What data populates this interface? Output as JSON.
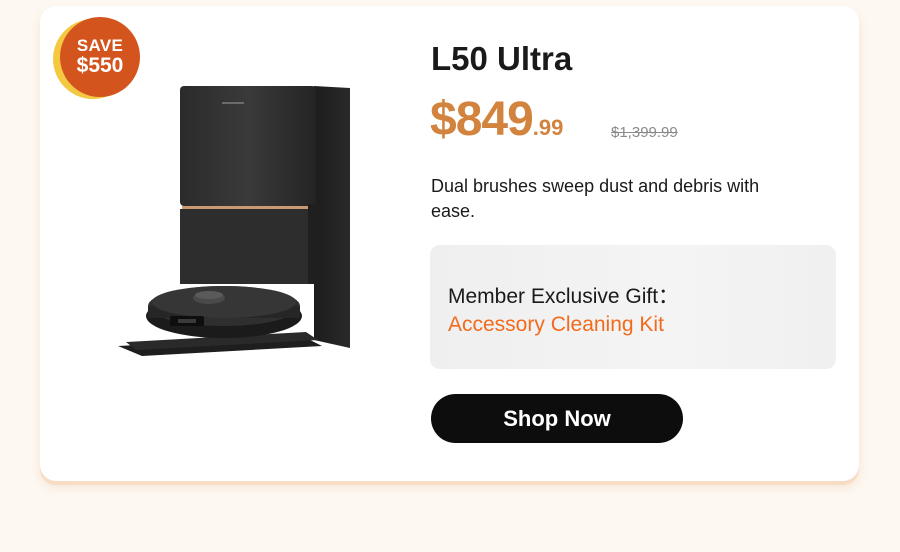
{
  "badge": {
    "top": "SAVE",
    "amount": "$550"
  },
  "product": {
    "title": "L50 Ultra",
    "price_main": "$849",
    "price_cents": ".99",
    "price_original": "$1,399.99",
    "description": "Dual brushes sweep dust and debris with ease.",
    "image_icon": "robot-vacuum-station-illustration"
  },
  "gift": {
    "label": "Member Exclusive Gift：",
    "item": "Accessory Cleaning Kit"
  },
  "cta": {
    "label": "Shop Now"
  },
  "colors": {
    "page_bg": "#fdf8f1",
    "card_bg": "#ffffff",
    "price": "#d2833e",
    "gift_item": "#f26b1d",
    "badge": "#d4541e",
    "badge_back": "#f5c842",
    "button": "#0d0d0d"
  }
}
